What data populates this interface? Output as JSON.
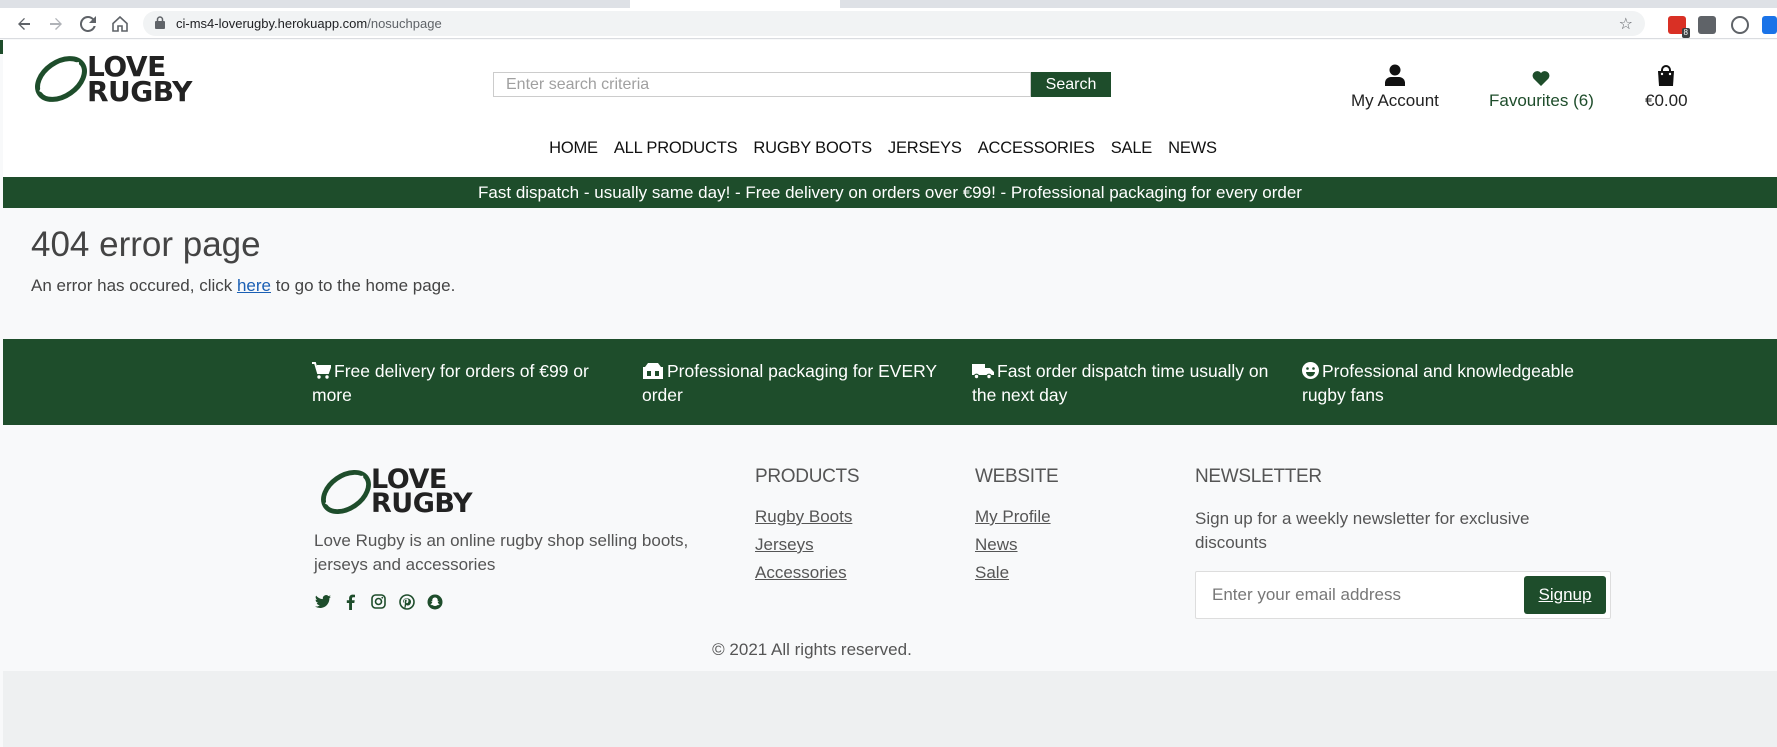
{
  "browser": {
    "url_host": "ci-ms4-loverugby.herokuapp.com",
    "url_path": "/nosuchpage",
    "extension_badge": "8"
  },
  "header": {
    "logo_line1": "LOVE",
    "logo_line2": "RUGBY",
    "search_placeholder": "Enter search criteria",
    "search_button": "Search",
    "account_label": "My Account",
    "favourites_label": "Favourites (6)",
    "cart_total": "€0.00"
  },
  "nav": {
    "items": [
      "HOME",
      "ALL PRODUCTS",
      "RUGBY BOOTS",
      "JERSEYS",
      "ACCESSORIES",
      "SALE",
      "NEWS"
    ]
  },
  "promo_bar": {
    "text": "Fast dispatch - usually same day! - Free delivery on orders over €99! - Professional packaging for every order"
  },
  "error": {
    "title": "404 error page",
    "text_before": "An error has occured, click ",
    "link": "here",
    "text_after": " to go to the home page."
  },
  "features": [
    {
      "icon": "cart-icon",
      "text": "Free delivery for orders of €99 or more"
    },
    {
      "icon": "box-icon",
      "text": "Professional packaging for EVERY order"
    },
    {
      "icon": "truck-icon",
      "text": "Fast order dispatch time usually on the next day"
    },
    {
      "icon": "smile-icon",
      "text": "Professional and knowledgeable rugby fans"
    }
  ],
  "footer": {
    "description": "Love Rugby is an online rugby shop selling boots, jerseys and accessories",
    "social_icons": [
      "twitter-icon",
      "facebook-icon",
      "instagram-icon",
      "pinterest-icon",
      "snapchat-icon"
    ],
    "products_heading": "PRODUCTS",
    "products_links": [
      "Rugby Boots",
      "Jerseys",
      "Accessories"
    ],
    "website_heading": "WEBSITE",
    "website_links": [
      "My Profile",
      "News",
      "Sale"
    ],
    "newsletter_heading": "NEWSLETTER",
    "newsletter_text": "Sign up for a weekly newsletter for exclusive discounts",
    "newsletter_placeholder": "Enter your email address",
    "newsletter_button": "Signup",
    "copyright": "© 2021 All rights reserved."
  },
  "colors": {
    "brand_green": "#1e4d2b",
    "link_blue": "#1a5fb4"
  }
}
